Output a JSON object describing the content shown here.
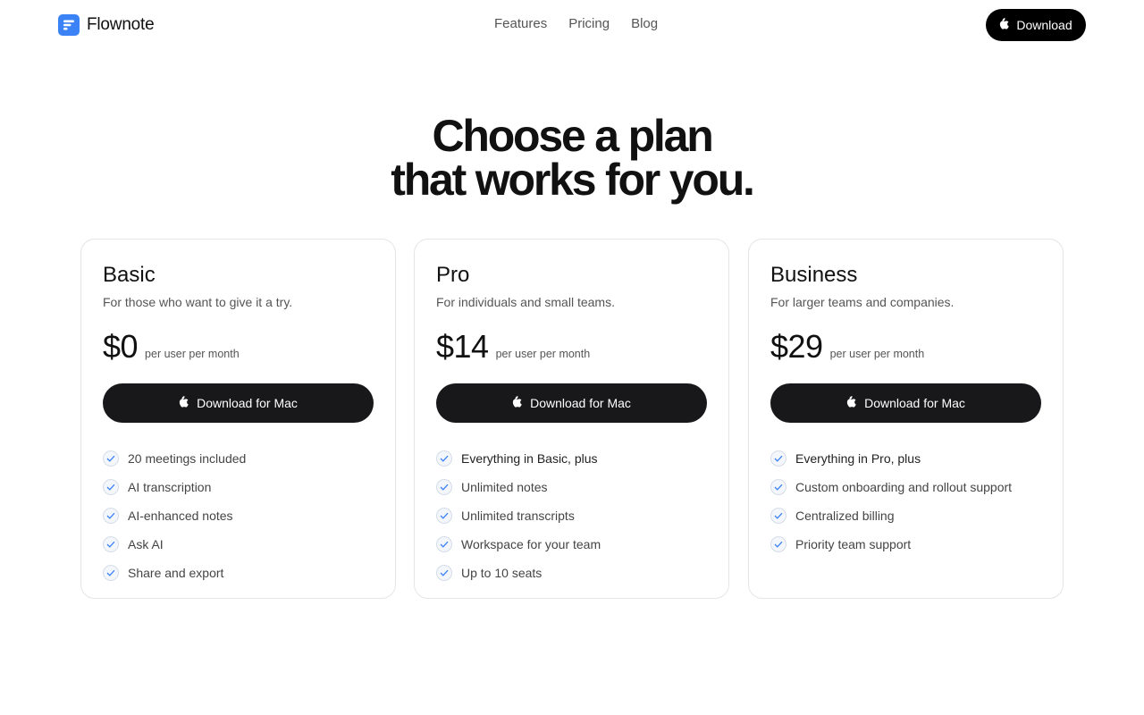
{
  "header": {
    "brand": "Flownote",
    "brand_icon": "flownote-logo-icon",
    "brand_color": "#3b82f6",
    "nav": [
      "Features",
      "Pricing",
      "Blog"
    ],
    "cta_label": "Download",
    "cta_icon": "apple-icon"
  },
  "hero": {
    "line1": "Choose a plan",
    "line2": "that works for you."
  },
  "plans": [
    {
      "name": "Basic",
      "description": "For those who want to give it a try.",
      "price": "$0",
      "price_unit": "per user per month",
      "cta": "Download for Mac",
      "features": [
        "20 meetings included",
        "AI transcription",
        "AI-enhanced notes",
        "Ask AI",
        "Share and export"
      ]
    },
    {
      "name": "Pro",
      "description": "For individuals and small teams.",
      "price": "$14",
      "price_unit": "per user per month",
      "cta": "Download for Mac",
      "features": [
        "Everything in Basic, plus",
        "Unlimited notes",
        "Unlimited transcripts",
        "Workspace for your team",
        "Up to 10 seats"
      ]
    },
    {
      "name": "Business",
      "description": "For larger teams and companies.",
      "price": "$29",
      "price_unit": "per user per month",
      "cta": "Download for Mac",
      "features": [
        "Everything in Pro, plus",
        "Custom onboarding and rollout support",
        "Centralized billing",
        "Priority team support"
      ]
    }
  ],
  "colors": {
    "button_bg": "#18181b",
    "check_color": "#3b82f6"
  }
}
